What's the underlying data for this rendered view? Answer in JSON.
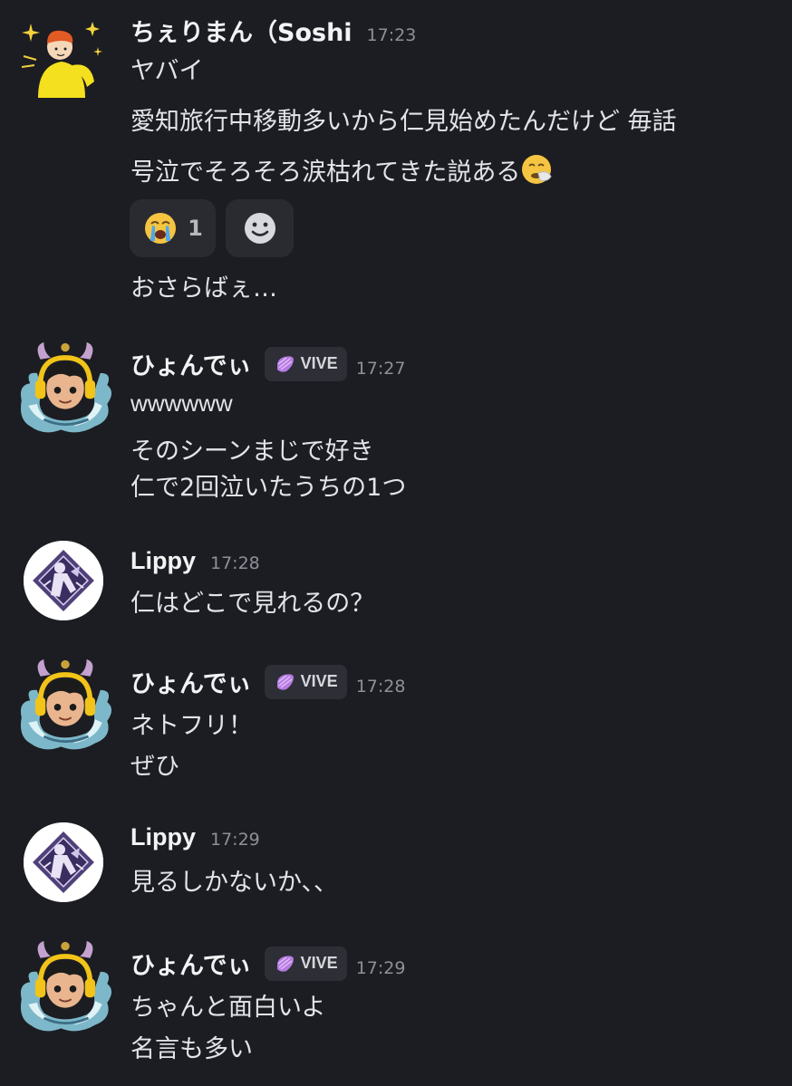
{
  "messages": [
    {
      "author": "ちぇりまん（Soshi",
      "time": "17:23",
      "lines": [
        "ヤバイ",
        "愛知旅行中移動多いから仁見始めたんだけど 毎話",
        "号泣でそろそろ涙枯れてきた説ある"
      ],
      "trailing_emoji": "sneezing-face",
      "reactions": [
        {
          "emoji": "loudly-crying-face",
          "count": "1"
        },
        {
          "emoji": "add-reaction-smiley"
        }
      ],
      "after_reaction_line": "おさらばぇ…"
    },
    {
      "author": "ひょんでぃ",
      "badge": "VIVE",
      "time": "17:27",
      "lines": [
        "wwwwww",
        "そのシーンまじで好き",
        "仁で2回泣いたうちの1つ"
      ]
    },
    {
      "author": "Lippy",
      "time": "17:28",
      "lines": [
        "仁はどこで見れるの？"
      ]
    },
    {
      "author": "ひょんでぃ",
      "badge": "VIVE",
      "time": "17:28",
      "lines": [
        "ネトフリ！",
        "ぜひ"
      ]
    },
    {
      "author": "Lippy",
      "time": "17:29",
      "lines": [
        "見るしかないか、、"
      ]
    },
    {
      "author": "ひょんでぃ",
      "badge": "VIVE",
      "time": "17:29",
      "lines": [
        "ちゃんと面白いよ",
        "名言も多い"
      ]
    }
  ],
  "colors": {
    "background": "#1c1d22",
    "text": "#e3e4e8",
    "timestamp": "#8e9099",
    "badge_bg": "#2e2f36",
    "badge_icon": "#b77be3",
    "reaction_bg": "#2a2b31"
  }
}
